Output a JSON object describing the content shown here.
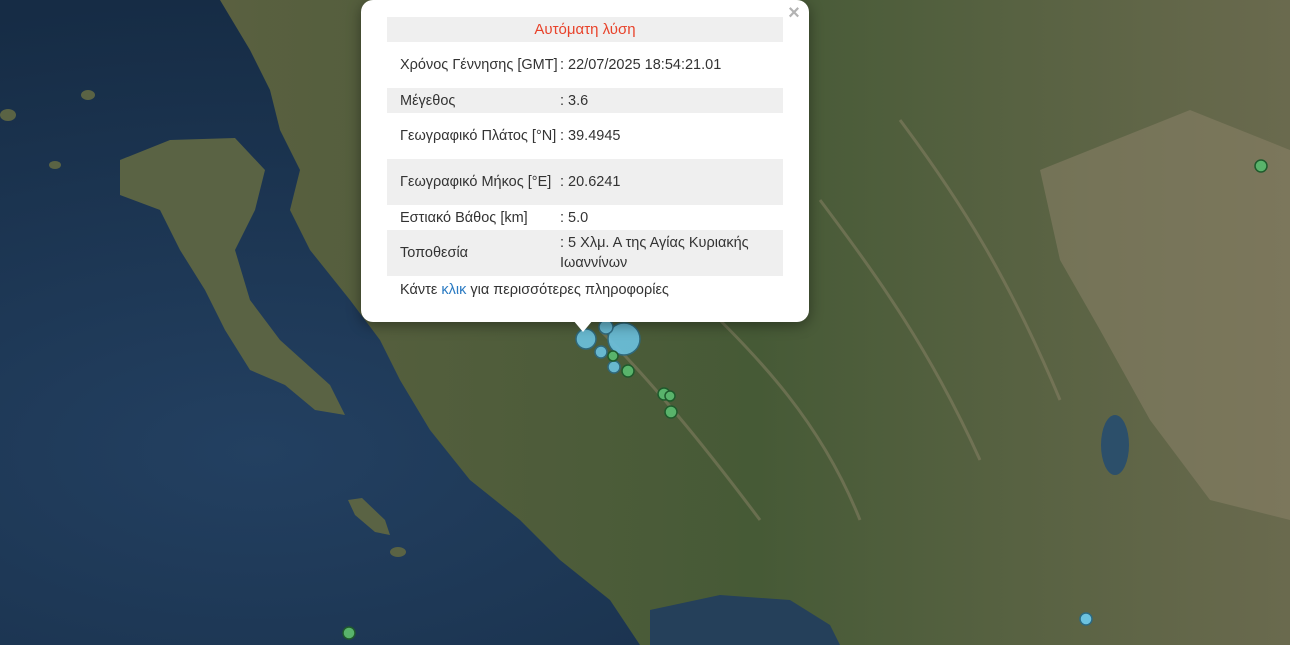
{
  "popup": {
    "title": "Αυτόματη λύση",
    "close_icon": "×",
    "rows": [
      {
        "label": "Χρόνος Γέννησης [GMT]",
        "value": ": 22/07/2025 18:54:21.01"
      },
      {
        "label": "Μέγεθος",
        "value": ": 3.6"
      },
      {
        "label": "Γεωγραφικό Πλάτος [°N]",
        "value": ": 39.4945"
      },
      {
        "label": "Γεωγραφικό Μήκος [°E]",
        "value": ": 20.6241"
      },
      {
        "label": "Εστιακό Βάθος [km]",
        "value": ": 5.0"
      },
      {
        "label": "Τοποθεσία",
        "value": ": 5 Χλμ. Α της Αγίας Κυριακής Ιωαννίνων"
      }
    ],
    "footer_before": "Κάντε ",
    "footer_link": "κλικ",
    "footer_after": " για περισσότερες πληροφορίες"
  },
  "colors": {
    "sea": "#1d3550",
    "land": "#4a5a38",
    "marker_blue": "#6cc2e0",
    "marker_green": "#59b36b",
    "title_red": "#e8422a",
    "link_blue": "#2a7ac2"
  }
}
